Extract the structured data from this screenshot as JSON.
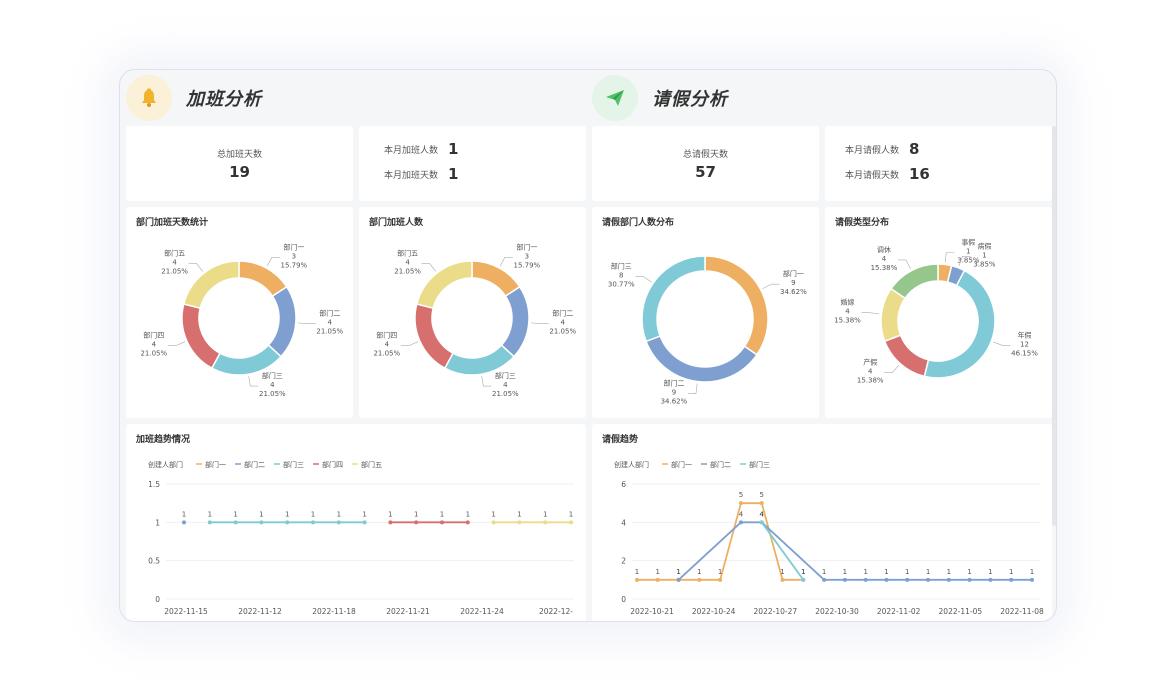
{
  "overtime": {
    "title": "加班分析",
    "total_days": {
      "label": "总加班天数",
      "value": "19"
    },
    "month_people": {
      "label": "本月加班人数",
      "value": "1"
    },
    "month_days": {
      "label": "本月加班天数",
      "value": "1"
    },
    "dept_days_title": "部门加班天数统计",
    "dept_people_title": "部门加班人数",
    "trend_title": "加班趋势情况"
  },
  "leave": {
    "title": "请假分析",
    "total_days": {
      "label": "总请假天数",
      "value": "57"
    },
    "month_people": {
      "label": "本月请假人数",
      "value": "8"
    },
    "month_days": {
      "label": "本月请假天数",
      "value": "16"
    },
    "dept_people_title": "请假部门人数分布",
    "type_title": "请假类型分布",
    "trend_title": "请假趋势"
  },
  "colors": {
    "orange": "#eeaf62",
    "blue": "#7e9fd0",
    "cyan": "#7fcad6",
    "red": "#d76f6f",
    "yellow": "#ebdc8a",
    "green": "#95c68b"
  },
  "icons": {
    "overtime": "bell-icon",
    "leave": "paper-plane-icon"
  },
  "chart_data": [
    {
      "type": "pie",
      "title": "部门加班天数统计",
      "slices": [
        {
          "name": "部门一",
          "value": 3,
          "pct": "15.79%",
          "color": "#eeaf62"
        },
        {
          "name": "部门二",
          "value": 4,
          "pct": "21.05%",
          "color": "#7e9fd0"
        },
        {
          "name": "部门三",
          "value": 4,
          "pct": "21.05%",
          "color": "#7fcad6"
        },
        {
          "name": "部门四",
          "value": 4,
          "pct": "21.05%",
          "color": "#d76f6f"
        },
        {
          "name": "部门五",
          "value": 4,
          "pct": "21.05%",
          "color": "#ebdc8a"
        }
      ]
    },
    {
      "type": "pie",
      "title": "部门加班人数",
      "slices": [
        {
          "name": "部门一",
          "value": 3,
          "pct": "15.79%",
          "color": "#eeaf62"
        },
        {
          "name": "部门二",
          "value": 4,
          "pct": "21.05%",
          "color": "#7e9fd0"
        },
        {
          "name": "部门三",
          "value": 4,
          "pct": "21.05%",
          "color": "#7fcad6"
        },
        {
          "name": "部门四",
          "value": 4,
          "pct": "21.05%",
          "color": "#d76f6f"
        },
        {
          "name": "部门五",
          "value": 4,
          "pct": "21.05%",
          "color": "#ebdc8a"
        }
      ]
    },
    {
      "type": "pie",
      "title": "请假部门人数分布",
      "slices": [
        {
          "name": "部门一",
          "value": 9,
          "pct": "34.62%",
          "color": "#eeaf62"
        },
        {
          "name": "部门二",
          "value": 9,
          "pct": "34.62%",
          "color": "#7e9fd0"
        },
        {
          "name": "部门三",
          "value": 8,
          "pct": "30.77%",
          "color": "#7fcad6"
        }
      ]
    },
    {
      "type": "pie",
      "title": "请假类型分布",
      "slices": [
        {
          "name": "事假",
          "value": 1,
          "pct": "3.85%",
          "color": "#eeaf62"
        },
        {
          "name": "病假",
          "value": 1,
          "pct": "3.85%",
          "color": "#7e9fd0"
        },
        {
          "name": "年假",
          "value": 12,
          "pct": "46.15%",
          "color": "#7fcad6"
        },
        {
          "name": "产假",
          "value": 4,
          "pct": "15.38%",
          "color": "#d76f6f"
        },
        {
          "name": "婚嫁",
          "value": 4,
          "pct": "15.38%",
          "color": "#ebdc8a"
        },
        {
          "name": "调休",
          "value": 4,
          "pct": "15.38%",
          "color": "#95c68b"
        }
      ]
    },
    {
      "type": "line",
      "title": "加班趋势情况",
      "legend_title": "创建人部门",
      "ylim": [
        0,
        1.5
      ],
      "yticks": [
        "1.5",
        "1",
        "0.5",
        "0"
      ],
      "xticks": [
        "2022-11-15",
        "2022-11-12",
        "2022-11-18",
        "2022-11-21",
        "2022-11-24",
        "2022-12-"
      ],
      "series": [
        {
          "name": "部门一",
          "color": "#eeaf62",
          "points": []
        },
        {
          "name": "部门二",
          "color": "#7e9fd0",
          "points": [
            {
              "x": 0,
              "y": 1
            }
          ]
        },
        {
          "name": "部门三",
          "color": "#7fcad6",
          "points": [
            {
              "x": 1,
              "y": 1
            },
            {
              "x": 2,
              "y": 1
            },
            {
              "x": 3,
              "y": 1
            },
            {
              "x": 4,
              "y": 1
            },
            {
              "x": 5,
              "y": 1
            },
            {
              "x": 6,
              "y": 1
            },
            {
              "x": 7,
              "y": 1
            }
          ]
        },
        {
          "name": "部门四",
          "color": "#d76f6f",
          "points": [
            {
              "x": 8,
              "y": 1
            },
            {
              "x": 9,
              "y": 1
            },
            {
              "x": 10,
              "y": 1
            },
            {
              "x": 11,
              "y": 1
            }
          ]
        },
        {
          "name": "部门五",
          "color": "#ebdc8a",
          "points": [
            {
              "x": 12,
              "y": 1
            },
            {
              "x": 13,
              "y": 1
            },
            {
              "x": 14,
              "y": 1
            },
            {
              "x": 15,
              "y": 1
            }
          ]
        }
      ]
    },
    {
      "type": "line",
      "title": "请假趋势",
      "legend_title": "创建人部门",
      "ylim": [
        0,
        6
      ],
      "yticks": [
        "6",
        "4",
        "2",
        "0"
      ],
      "xticks": [
        "2022-10-21",
        "2022-10-24",
        "2022-10-27",
        "2022-10-30",
        "2022-11-02",
        "2022-11-05",
        "2022-11-08"
      ],
      "series": [
        {
          "name": "部门一",
          "color": "#eeaf62",
          "points": [
            {
              "x": 0,
              "y": 1
            },
            {
              "x": 1,
              "y": 1
            },
            {
              "x": 2,
              "y": 1
            },
            {
              "x": 3,
              "y": 1
            },
            {
              "x": 4,
              "y": 1
            },
            {
              "x": 5,
              "y": 5
            },
            {
              "x": 6,
              "y": 5
            },
            {
              "x": 7,
              "y": 1
            },
            {
              "x": 8,
              "y": 1
            }
          ]
        },
        {
          "name": "部门二",
          "color": "#7e9fd0",
          "points": [
            {
              "x": 2,
              "y": 1
            },
            {
              "x": 5,
              "y": 4
            },
            {
              "x": 6,
              "y": 4
            },
            {
              "x": 9,
              "y": 1
            },
            {
              "x": 10,
              "y": 1
            },
            {
              "x": 11,
              "y": 1
            },
            {
              "x": 12,
              "y": 1
            },
            {
              "x": 13,
              "y": 1
            },
            {
              "x": 14,
              "y": 1
            },
            {
              "x": 15,
              "y": 1
            },
            {
              "x": 16,
              "y": 1
            },
            {
              "x": 17,
              "y": 1
            },
            {
              "x": 18,
              "y": 1
            },
            {
              "x": 19,
              "y": 1
            }
          ]
        },
        {
          "name": "部门三",
          "color": "#7fcad6",
          "points": [
            {
              "x": 6,
              "y": 4
            },
            {
              "x": 8,
              "y": 1
            }
          ]
        }
      ]
    }
  ]
}
